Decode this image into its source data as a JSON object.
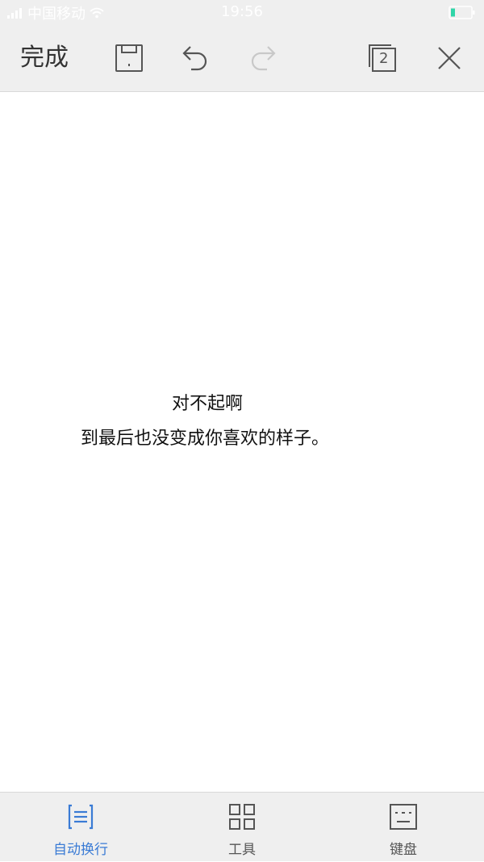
{
  "status_bar": {
    "carrier": "中国移动",
    "time": "19:56"
  },
  "toolbar": {
    "done_label": "完成",
    "page_count": "2"
  },
  "editor": {
    "line1": "对不起啊",
    "line2": "到最后也没变成你喜欢的样子。"
  },
  "bottom_bar": {
    "items": [
      {
        "label": "自动换行",
        "icon": "wrap-text-icon",
        "active": true
      },
      {
        "label": "工具",
        "icon": "grid-icon",
        "active": false
      },
      {
        "label": "键盘",
        "icon": "keyboard-icon",
        "active": false
      }
    ]
  },
  "colors": {
    "accent": "#3a7bd5",
    "bar_bg": "#efefef",
    "icon_gray": "#555555",
    "disabled_gray": "#c8c8c8",
    "battery_green": "#2fd5a8"
  }
}
